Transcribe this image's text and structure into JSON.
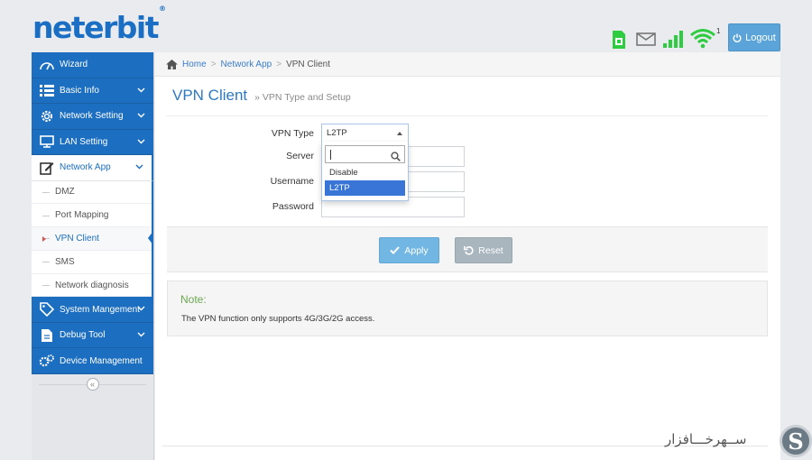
{
  "header": {
    "logo": "neterbit",
    "logo_mark": "®",
    "signal_badge": "1",
    "logout_label": "Logout"
  },
  "sidebar": {
    "items": [
      {
        "label": "Wizard",
        "icon": "speedometer-icon"
      },
      {
        "label": "Basic Info",
        "icon": "list-icon"
      },
      {
        "label": "Network Setting",
        "icon": "gear-icon"
      },
      {
        "label": "LAN Setting",
        "icon": "monitor-icon"
      },
      {
        "label": "Network App",
        "icon": "edit-icon"
      },
      {
        "label": "System Mangement",
        "icon": "tag-icon"
      },
      {
        "label": "Debug Tool",
        "icon": "file-icon"
      },
      {
        "label": "Device Management",
        "icon": "gears-icon"
      }
    ],
    "sub_items": [
      "DMZ",
      "Port Mapping",
      "VPN Client",
      "SMS",
      "Network diagnosis"
    ],
    "collapse_symbol": "«"
  },
  "breadcrumb": {
    "home": "Home",
    "section": "Network App",
    "current": "VPN Client",
    "separator": ">"
  },
  "page": {
    "title": "VPN Client",
    "subtitle": "» VPN Type and Setup"
  },
  "form": {
    "vpn_type_label": "VPN Type",
    "vpn_type_value": "L2TP",
    "server_label": "Server",
    "server_value": "",
    "username_label": "Username",
    "username_value": "",
    "password_label": "Password",
    "password_value": "",
    "dropdown_search_value": "",
    "options": [
      "Disable",
      "L2TP"
    ]
  },
  "buttons": {
    "apply": "Apply",
    "reset": "Reset"
  },
  "note": {
    "title": "Note:",
    "text": "The VPN function only supports 4G/3G/2G access."
  },
  "watermark": {
    "text": "ســهر‌خـــافزار",
    "logo_letter": "S"
  },
  "colors": {
    "brand_blue": "#1c6ec0",
    "logo_blue": "#1a6fc4",
    "status_green": "#2ecc40",
    "apply_blue": "#72b6e4",
    "reset_gray": "#a9b6be",
    "note_green": "#6aa84f"
  }
}
